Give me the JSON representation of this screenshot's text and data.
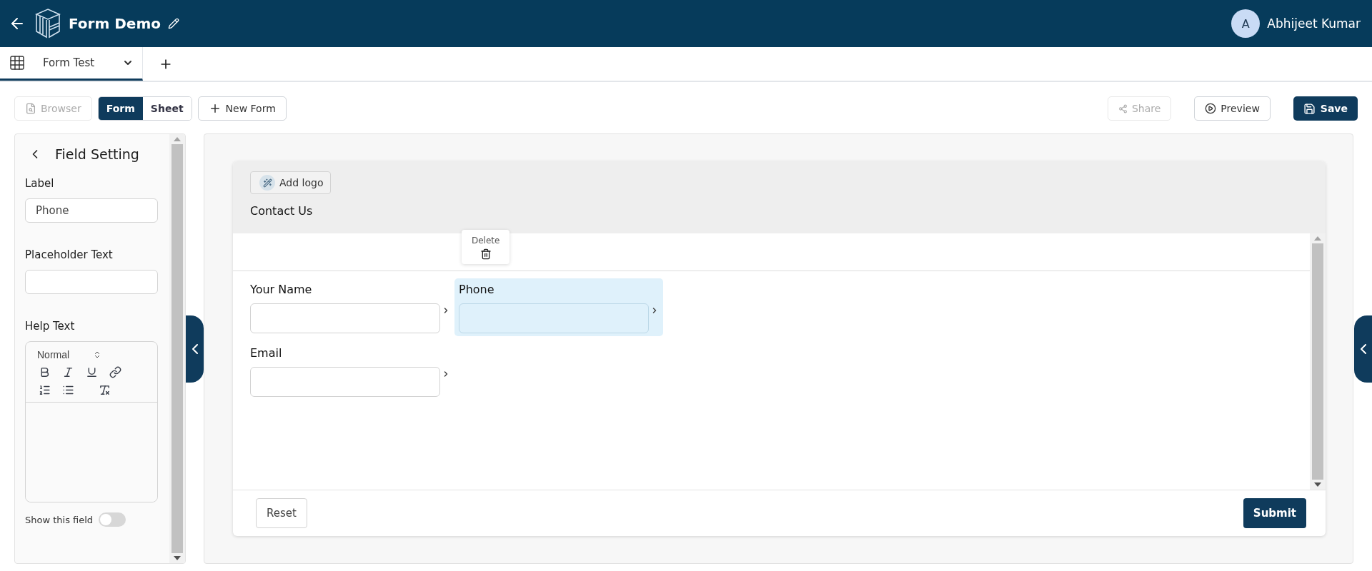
{
  "header": {
    "title": "Form Demo",
    "user": {
      "initial": "A",
      "name": "Abhijeet Kumar"
    }
  },
  "tabs": [
    {
      "label": "Form Test",
      "selected": true
    }
  ],
  "toolbar": {
    "browser": {
      "label": "Browser",
      "disabled": true
    },
    "view_toggle": [
      {
        "label": "Form",
        "selected": true
      },
      {
        "label": "Sheet",
        "selected": false
      }
    ],
    "new_form": "New Form",
    "share": {
      "label": "Share",
      "disabled": true
    },
    "preview": "Preview",
    "save": "Save"
  },
  "field_setting": {
    "title": "Field Setting",
    "label": {
      "caption": "Label",
      "value": "Phone"
    },
    "placeholder_text": {
      "caption": "Placeholder Text"
    },
    "help_text": {
      "caption": "Help Text",
      "format": "Normal"
    },
    "show_field": {
      "caption": "Show this field",
      "on": false
    }
  },
  "form": {
    "add_logo": "Add logo",
    "title": "Contact Us",
    "delete_tooltip": "Delete",
    "fields": [
      {
        "label": "Your Name",
        "selected": false
      },
      {
        "label": "Phone",
        "selected": true
      },
      {
        "label": "Email",
        "selected": false
      }
    ],
    "reset": "Reset",
    "submit": "Submit"
  }
}
